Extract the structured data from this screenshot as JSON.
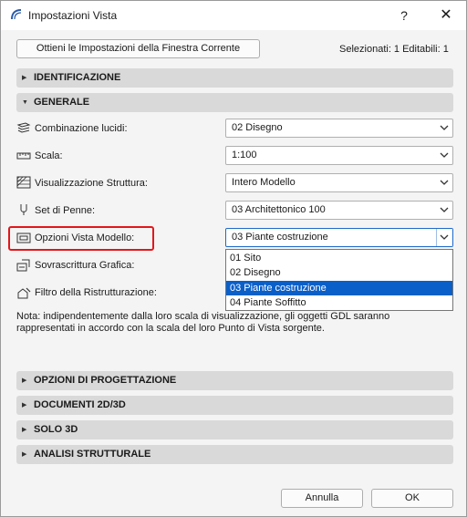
{
  "window": {
    "title": "Impostazioni Vista",
    "help_label": "?",
    "close_label": "✕"
  },
  "toolbar": {
    "get_settings_label": "Ottieni le Impostazioni della Finestra Corrente",
    "selection_info": "Selezionati: 1 Editabili: 1"
  },
  "sections": {
    "identificazione": "IDENTIFICAZIONE",
    "generale": "GENERALE",
    "progettazione": "OPZIONI DI PROGETTAZIONE",
    "documenti": "DOCUMENTI 2D/3D",
    "solo3d": "SOLO 3D",
    "analisi": "ANALISI STRUTTURALE"
  },
  "general": {
    "layer_combo": {
      "label": "Combinazione lucidi:",
      "value": "02 Disegno",
      "icon": "layers-icon"
    },
    "scale": {
      "label": "Scala:",
      "value": "1:100",
      "icon": "scale-ruler-icon"
    },
    "structure_display": {
      "label": "Visualizzazione Struttura:",
      "value": "Intero Modello",
      "icon": "structure-icon"
    },
    "pen_set": {
      "label": "Set di Penne:",
      "value": "03 Architettonico 100",
      "icon": "pen-icon"
    },
    "model_view": {
      "label": "Opzioni Vista Modello:",
      "value": "03 Piante costruzione",
      "icon": "model-view-icon"
    },
    "graphic_override": {
      "label": "Sovrascrittura Grafica:",
      "icon": "graphic-override-icon"
    },
    "renovation_filter": {
      "label": "Filtro della Ristrutturazione:",
      "icon": "renovation-filter-icon"
    }
  },
  "dropdown": {
    "options": [
      "01 Sito",
      "02 Disegno",
      "03 Piante costruzione",
      "04 Piante Soffitto"
    ],
    "selected_index": 2
  },
  "note": "Nota: indipendentemente dalla loro scala di visualizzazione, gli oggetti GDL saranno rappresentati in accordo con la scala del loro Punto di Vista sorgente.",
  "footer": {
    "cancel_label": "Annulla",
    "ok_label": "OK"
  },
  "colors": {
    "highlight": "#0a5fc8",
    "callout": "#e3161b",
    "section_bg": "#d9d9d9"
  }
}
